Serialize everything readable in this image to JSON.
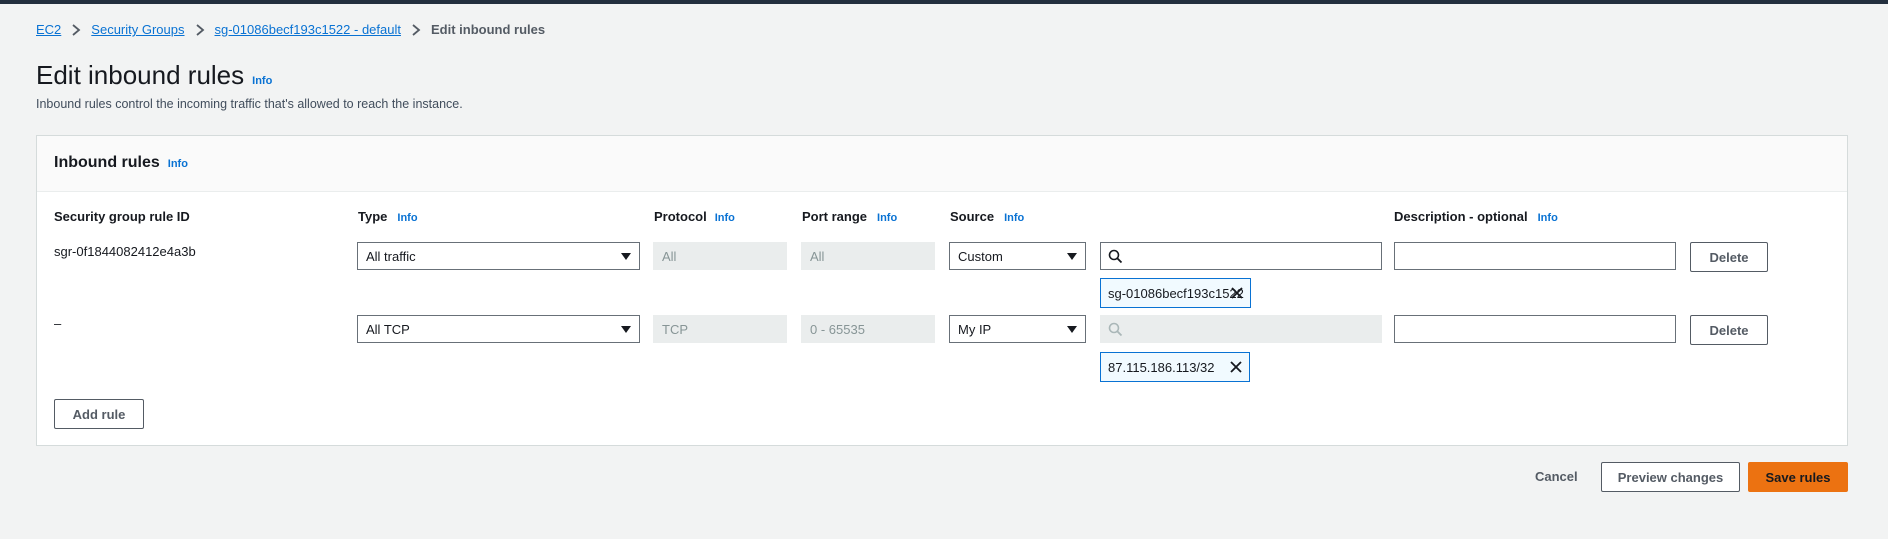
{
  "breadcrumb": {
    "items": [
      "EC2",
      "Security Groups",
      "sg-01086becf193c1522 - default"
    ],
    "current": "Edit inbound rules"
  },
  "page": {
    "title": "Edit inbound rules",
    "info": "Info",
    "description": "Inbound rules control the incoming traffic that's allowed to reach the instance."
  },
  "panel": {
    "title": "Inbound rules",
    "info": "Info"
  },
  "columns": {
    "rule_id": "Security group rule ID",
    "type": "Type",
    "protocol": "Protocol",
    "port_range": "Port range",
    "source": "Source",
    "description": "Description - optional",
    "info": "Info"
  },
  "rows": [
    {
      "rule_id": "sgr-0f1844082412e4a3b",
      "type": "All traffic",
      "protocol": "All",
      "port_range": "All",
      "source": "Custom",
      "token": "sg-01086becf193c1522",
      "delete": "Delete"
    },
    {
      "rule_id": "–",
      "type": "All TCP",
      "protocol": "TCP",
      "port_range": "0 - 65535",
      "source": "My IP",
      "token": "87.115.186.113/32",
      "delete": "Delete"
    }
  ],
  "actions": {
    "add_rule": "Add rule",
    "cancel": "Cancel",
    "preview": "Preview changes",
    "save": "Save rules"
  },
  "colors": {
    "link": "#0972d3",
    "primary_button": "#ec7211",
    "background": "#f2f3f3"
  }
}
